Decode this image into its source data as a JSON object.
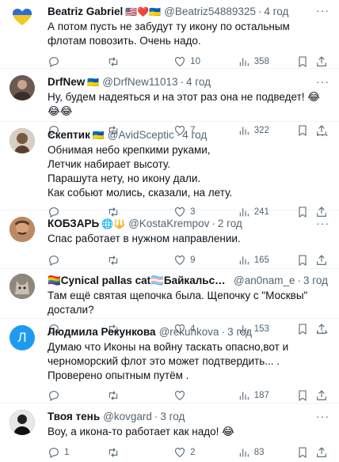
{
  "colors": {
    "text": "#0f1419",
    "muted": "#536471",
    "divider": "#eff3f4"
  },
  "tweets": [
    {
      "name": "Beatriz Gabriel",
      "flags": "🇺🇸❤️🇺🇦",
      "handle": "@Beatriz54889325",
      "time": "4 год",
      "text": "А потом пусть не забудут ту икону по остальным флотам повозить. Очень надо.",
      "replies": "",
      "retweets": "",
      "likes": "10",
      "views": "358",
      "avatar_icon": "ukraine-heart-avatar",
      "avatar_color": "#f3c623"
    },
    {
      "name": "DrfNew",
      "flags": "🇺🇦",
      "handle": "@DrfNew11013",
      "time": "4 год",
      "text": "Ну, будем надеяться и на этот раз она не подведет! 😂😂😂",
      "replies": "",
      "retweets": "",
      "likes": "7",
      "views": "322",
      "avatar_icon": "person-avatar",
      "avatar_color": "#6b5a52"
    },
    {
      "name": "Скептик",
      "flags": "🇺🇦",
      "handle": "@AvidSceptic",
      "time": "4 год",
      "text": "Обнимая небо крепкими руками,\nЛетчик набирает высоту.\nПарашута нету, но икону дали.\nКак собьют молись, сказали, на лету.",
      "replies": "",
      "retweets": "",
      "likes": "3",
      "views": "241",
      "avatar_icon": "person-avatar",
      "avatar_color": "#8a6a4c"
    },
    {
      "name": "КОБЗАРЬ",
      "flags": "🌐🔱",
      "handle": "@KostaKrempov",
      "time": "2 год",
      "text": "Спас работает в нужном направлении.",
      "replies": "",
      "retweets": "",
      "likes": "9",
      "views": "165",
      "avatar_icon": "person-avatar",
      "avatar_color": "#9a6a4a"
    },
    {
      "name": "🏳️‍🌈Cynical pallas cat🏳️‍⚧️Байкальський нелегал",
      "flags": "",
      "handle": "@an0nam_e",
      "time": "3 год",
      "text": "Там ещё святая щепочка была. Щепочку с \"Москвы\" достали?",
      "replies": "",
      "retweets": "",
      "likes": "4",
      "views": "153",
      "avatar_icon": "cat-avatar",
      "avatar_color": "#7c756c"
    },
    {
      "name": "Людмила Рекункова",
      "flags": "",
      "handle": "@rekunkova",
      "time": "3 год",
      "text": "Думаю что Иконы на войну таскать опасно,вот и черноморский флот это может подтвердить... .\nПроверено опытным путём .",
      "replies": "",
      "retweets": "",
      "likes": "",
      "views": "187",
      "avatar_icon": "letter-avatar",
      "avatar_letter": "Л",
      "avatar_color": "#1d9bf0"
    },
    {
      "name": "Твоя тень",
      "flags": "",
      "handle": "@kovgard",
      "time": "3 год",
      "text": "Воу, а икона-то работает как надо! 😂",
      "replies": "1",
      "retweets": "",
      "likes": "2",
      "views": "83",
      "avatar_icon": "person-avatar",
      "avatar_color": "#3a3a3a"
    }
  ]
}
